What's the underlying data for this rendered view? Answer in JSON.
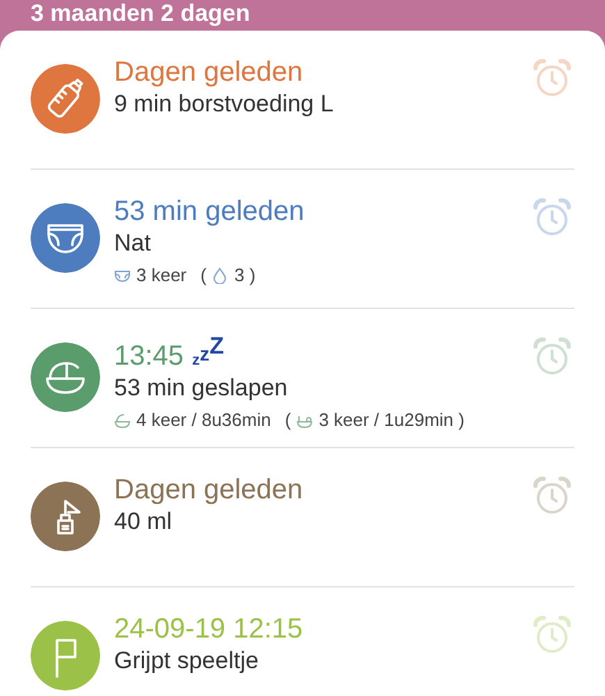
{
  "header": {
    "age": "3 maanden 2 dagen"
  },
  "entries": [
    {
      "kind": "bottle",
      "color": "#e0763f",
      "title": "Dagen geleden",
      "subtitle": "9 min borstvoeding L"
    },
    {
      "kind": "diaper",
      "color": "#4d7dbf",
      "title": "53 min geleden",
      "subtitle": "Nat",
      "stats": [
        {
          "kind": "diaper",
          "text": "3 keer"
        },
        {
          "kind": "plain",
          "text": "("
        },
        {
          "kind": "drop",
          "text": "3 )"
        }
      ]
    },
    {
      "kind": "crib",
      "color": "#5b9c6d",
      "title": "13:45",
      "badge": "zzZ",
      "subtitle": "53 min geslapen",
      "stats": [
        {
          "kind": "crib",
          "text": "4 keer / 8u36min"
        },
        {
          "kind": "plain",
          "text": "("
        },
        {
          "kind": "nap",
          "text": "3 keer / 1u29min )"
        }
      ]
    },
    {
      "kind": "pump",
      "color": "#8c7356",
      "title": "Dagen geleden",
      "subtitle": "40 ml"
    },
    {
      "kind": "flag",
      "color": "#9bc149",
      "title": "24-09-19 12:15",
      "subtitle": "Grijpt speeltje"
    }
  ]
}
